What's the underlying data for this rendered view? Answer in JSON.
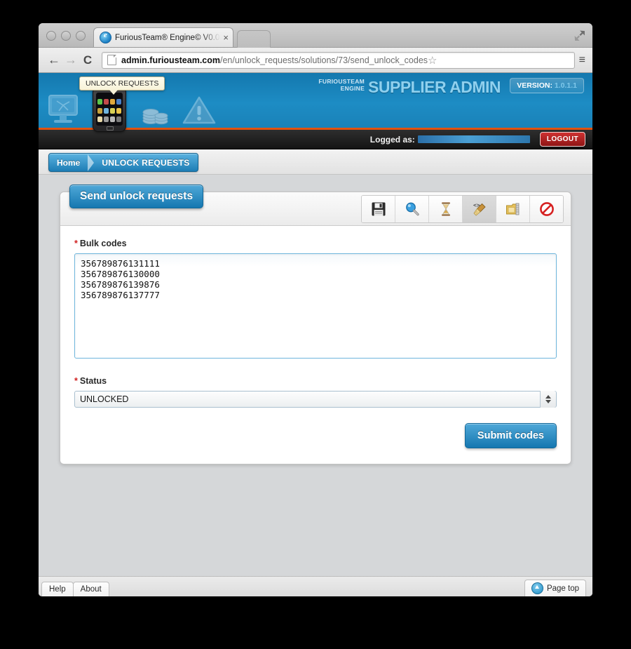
{
  "browser": {
    "tab_title": "FuriousTeam® Engine© V0.0",
    "tab_close": "×",
    "back_icon": "←",
    "forward_icon": "→",
    "reload_icon": "C",
    "url_domain": "admin.furiousteam.com",
    "url_path": "/en/unlock_requests/solutions/73/send_unlock_codes",
    "star_icon": "☆",
    "menu_icon": "≡"
  },
  "header": {
    "tooltip": "UNLOCK REQUESTS",
    "brand_line1": "FURIOUSTEAM",
    "brand_line2": "ENGINE",
    "brand_main": "SUPPLIER ADMIN",
    "version_label": "VERSION:",
    "version_value": "1.0.1.1",
    "accent_color": "#e2520f",
    "blue_color": "#1a82b8"
  },
  "session": {
    "logged_label": "Logged as:",
    "logged_user": "",
    "logout_label": "LOGOUT"
  },
  "breadcrumb": {
    "home": "Home",
    "current": "UNLOCK REQUESTS"
  },
  "panel": {
    "title": "Send unlock requests",
    "toolbar": [
      {
        "name": "save-icon",
        "title": "Save",
        "active": false
      },
      {
        "name": "search-icon",
        "title": "Search",
        "active": false
      },
      {
        "name": "hourglass-icon",
        "title": "Pending",
        "active": false
      },
      {
        "name": "broom-icon",
        "title": "Clean",
        "active": true
      },
      {
        "name": "archive-icon",
        "title": "Archive",
        "active": false
      },
      {
        "name": "cancel-icon",
        "title": "Cancel",
        "active": false
      }
    ]
  },
  "form": {
    "required_mark": "*",
    "bulk_label": "Bulk codes",
    "bulk_value": "356789876131111\n356789876130000\n356789876139876\n356789876137777",
    "bulk_placeholder": "",
    "status_label": "Status",
    "status_value": "UNLOCKED",
    "status_options": [
      "UNLOCKED"
    ],
    "submit_label": "Submit codes"
  },
  "footer": {
    "help": "Help",
    "about": "About",
    "page_top": "Page top"
  }
}
